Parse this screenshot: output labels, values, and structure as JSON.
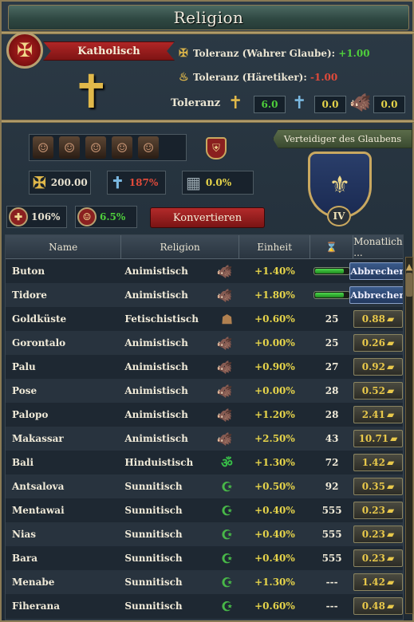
{
  "window": {
    "title": "Religion"
  },
  "religion": {
    "name": "Katholisch",
    "tolerance_true": {
      "label": "Toleranz (Wahrer Glaube):",
      "value": "+1.00"
    },
    "tolerance_heretic": {
      "label": "Toleranz (Häretiker):",
      "value": "-1.00"
    },
    "tolerance_label": "Toleranz",
    "tolerance_values": [
      "6.0",
      "0.0",
      "0.0"
    ]
  },
  "defender": {
    "label": "Verteidiger des Glaubens",
    "level": "IV"
  },
  "stats": {
    "missionary_value": "200.00",
    "missionary_strength": "187%",
    "fortification": "0.0%",
    "unrest_percent": "106%",
    "conversion_percent": "6.5%"
  },
  "buttons": {
    "convert": "Konvertieren",
    "cancel": "Abbrechen"
  },
  "table": {
    "headers": {
      "name": "Name",
      "religion": "Religion",
      "unit": "Einheit",
      "time": "⌛",
      "monthly": "Monatlich ..."
    },
    "rows": [
      {
        "name": "Buton",
        "religion": "Animistisch",
        "icon": "animist",
        "unit": "+1.40%",
        "time": "",
        "monthly": "",
        "in_progress": true,
        "progress": 0.85
      },
      {
        "name": "Tidore",
        "religion": "Animistisch",
        "icon": "animist",
        "unit": "+1.80%",
        "time": "",
        "monthly": "",
        "in_progress": true,
        "progress": 0.85
      },
      {
        "name": "Goldküste",
        "religion": "Fetischistisch",
        "icon": "fetish",
        "unit": "+0.60%",
        "time": "25",
        "monthly": "0.88",
        "in_progress": false
      },
      {
        "name": "Gorontalo",
        "religion": "Animistisch",
        "icon": "animist",
        "unit": "+0.00%",
        "time": "25",
        "monthly": "0.26",
        "in_progress": false
      },
      {
        "name": "Palu",
        "religion": "Animistisch",
        "icon": "animist",
        "unit": "+0.90%",
        "time": "27",
        "monthly": "0.92",
        "in_progress": false
      },
      {
        "name": "Pose",
        "religion": "Animistisch",
        "icon": "animist",
        "unit": "+0.00%",
        "time": "28",
        "monthly": "0.52",
        "in_progress": false
      },
      {
        "name": "Palopo",
        "religion": "Animistisch",
        "icon": "animist",
        "unit": "+1.20%",
        "time": "28",
        "monthly": "2.41",
        "in_progress": false
      },
      {
        "name": "Makassar",
        "religion": "Animistisch",
        "icon": "animist",
        "unit": "+2.50%",
        "time": "43",
        "monthly": "10.71",
        "in_progress": false
      },
      {
        "name": "Bali",
        "religion": "Hinduistisch",
        "icon": "hindu",
        "unit": "+1.30%",
        "time": "72",
        "monthly": "1.42",
        "in_progress": false
      },
      {
        "name": "Antsalova",
        "religion": "Sunnitisch",
        "icon": "sunni",
        "unit": "+0.50%",
        "time": "92",
        "monthly": "0.35",
        "in_progress": false
      },
      {
        "name": "Mentawai",
        "religion": "Sunnitisch",
        "icon": "sunni",
        "unit": "+0.40%",
        "time": "555",
        "monthly": "0.23",
        "in_progress": false
      },
      {
        "name": "Nias",
        "religion": "Sunnitisch",
        "icon": "sunni",
        "unit": "+0.40%",
        "time": "555",
        "monthly": "0.23",
        "in_progress": false
      },
      {
        "name": "Bara",
        "religion": "Sunnitisch",
        "icon": "sunni",
        "unit": "+0.40%",
        "time": "555",
        "monthly": "0.23",
        "in_progress": false
      },
      {
        "name": "Menabe",
        "religion": "Sunnitisch",
        "icon": "sunni",
        "unit": "+1.30%",
        "time": "---",
        "monthly": "1.42",
        "in_progress": false
      },
      {
        "name": "Fiherana",
        "religion": "Sunnitisch",
        "icon": "sunni",
        "unit": "+0.60%",
        "time": "---",
        "monthly": "0.48",
        "in_progress": false
      }
    ]
  },
  "colors": {
    "positive": "#4fcf3c",
    "negative": "#e04a3a",
    "highlight": "#e6d44a",
    "banner_red": "#b02626"
  }
}
